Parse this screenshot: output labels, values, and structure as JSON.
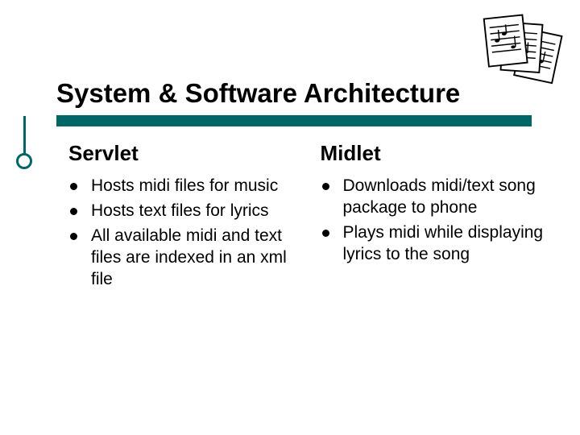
{
  "title": "System & Software Architecture",
  "columns": [
    {
      "heading": "Servlet",
      "items": [
        "Hosts midi files for music",
        "Hosts text files for lyrics",
        "All available midi and text files are indexed in an xml file"
      ]
    },
    {
      "heading": "Midlet",
      "items": [
        "Downloads midi/text song package to phone",
        "Plays midi while displaying lyrics to the song"
      ]
    }
  ],
  "icon": "music-sheets-icon"
}
